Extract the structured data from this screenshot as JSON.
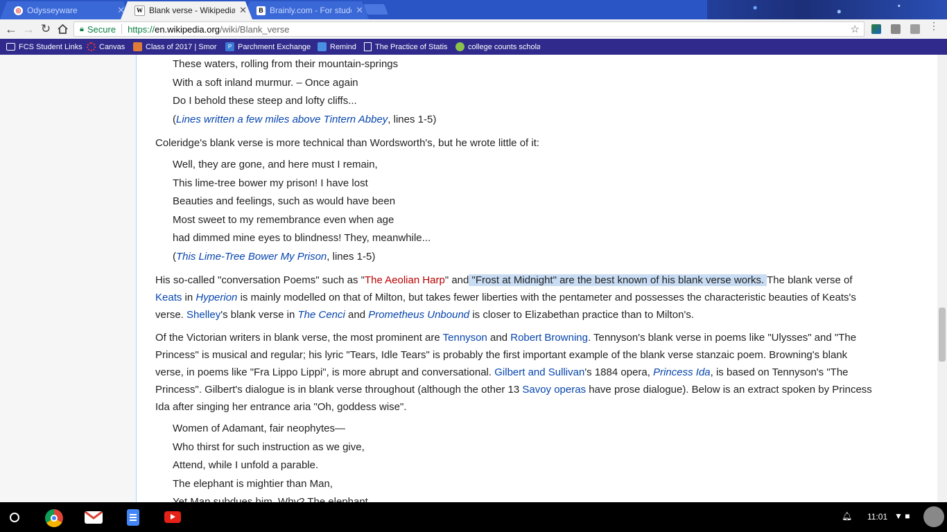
{
  "tabs": [
    {
      "title": "Odysseyware",
      "favicon": "odysseyware-icon"
    },
    {
      "title": "Blank verse - Wikipedia",
      "favicon": "wikipedia-icon"
    },
    {
      "title": "Brainly.com - For studer",
      "favicon": "brainly-icon"
    }
  ],
  "toolbar": {
    "secure_label": "Secure",
    "url_scheme": "https://",
    "url_host": "en.wikipedia.org",
    "url_path": "/wiki/Blank_verse"
  },
  "bookmarks": [
    {
      "label": "FCS Student Links",
      "icon": "folder-icon"
    },
    {
      "label": "Canvas",
      "icon": "canvas-icon"
    },
    {
      "label": "Class of 2017 | Smor",
      "icon": "class-icon"
    },
    {
      "label": "Parchment Exchange",
      "icon": "parchment-icon"
    },
    {
      "label": "Remind",
      "icon": "remind-icon"
    },
    {
      "label": "The Practice of Statis",
      "icon": "document-icon"
    },
    {
      "label": "college counts schola",
      "icon": "college-icon"
    }
  ],
  "content": {
    "verse1": [
      "These waters, rolling from their mountain-springs",
      "With a soft inland murmur. – Once again",
      "Do I behold these steep and lofty cliffs..."
    ],
    "cite1_open": "(",
    "cite1_link": "Lines written a few miles above Tintern Abbey",
    "cite1_rest": ", lines 1-5)",
    "para_coleridge": "Coleridge's blank verse is more technical than Wordsworth's, but he wrote little of it:",
    "verse2": [
      "Well, they are gone, and here must I remain,",
      "This lime-tree bower my prison! I have lost",
      "Beauties and feelings, such as would have been",
      "Most sweet to my remembrance even when age",
      "had dimmed mine eyes to blindness! They, meanwhile..."
    ],
    "cite2_open": "(",
    "cite2_link": "This Lime-Tree Bower My Prison",
    "cite2_rest": ", lines 1-5)",
    "p3": {
      "t1": "His so-called \"conversation Poems\" such as \"",
      "aeolian": "The Aeolian Harp",
      "t2": "\" and",
      "highlight": " \"Frost at Midnight\" are the best known of his blank verse works. ",
      "t3": "The blank verse of",
      "keats": "Keats",
      "t4": " in ",
      "hyperion": "Hyperion",
      "t5": " is mainly modelled on that of Milton, but takes fewer liberties with the pentameter and possesses the characteristic beauties of Keats's",
      "t6": "verse. ",
      "shelley": "Shelley",
      "t7": "'s blank verse in ",
      "cenci": "The Cenci",
      "t8": " and ",
      "prometheus": "Prometheus Unbound",
      "t9": " is closer to Elizabethan practice than to Milton's."
    },
    "p4": {
      "t1": "Of the Victorian writers in blank verse, the most prominent are ",
      "tennyson": "Tennyson",
      "t2": " and ",
      "browning": "Robert Browning",
      "t3": ". Tennyson's blank verse in poems like \"Ulysses\" and \"The",
      "t4": "Princess\" is musical and regular; his lyric \"Tears, Idle Tears\" is probably the first important example of the blank verse stanzaic poem. Browning's blank",
      "t5": "verse, in poems like \"Fra Lippo Lippi\", is more abrupt and conversational. ",
      "gs": "Gilbert and Sullivan",
      "t6": "'s 1884 opera, ",
      "ida": "Princess Ida",
      "t7": ", is based on Tennyson's \"The",
      "t8": "Princess\". Gilbert's dialogue is in blank verse throughout (although the other 13 ",
      "savoy": "Savoy operas",
      "t9": " have prose dialogue). Below is an extract spoken by Princess",
      "t10": "Ida after singing her entrance aria \"Oh, goddess wise\"."
    },
    "verse3": [
      "Women of Adamant, fair neophytes—",
      "Who thirst for such instruction as we give,",
      "Attend, while I unfold a parable.",
      "The elephant is mightier than Man,",
      "Yet Man subdues him. Why? The elephant"
    ]
  },
  "shelf": {
    "clock": "11:01",
    "apps": [
      "chrome-icon",
      "gmail-icon",
      "docs-icon",
      "youtube-icon"
    ]
  },
  "colors": {
    "tabstrip": "#2a55c4",
    "bookmarks_bar": "#2f2a8c",
    "link": "#0645ad",
    "redlink": "#ba0000",
    "highlight": "#c8dcf3"
  }
}
